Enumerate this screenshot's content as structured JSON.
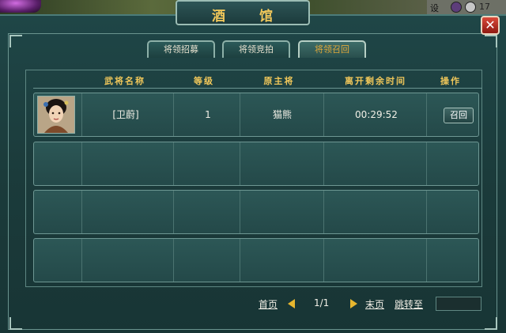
{
  "window": {
    "title_char_1": "酒",
    "title_char_2": "馆",
    "close_label": "✕"
  },
  "topbar": {
    "settings_label": "设",
    "right_digits": "17"
  },
  "tabs": [
    {
      "label": "将领招募",
      "active": false
    },
    {
      "label": "将领竞拍",
      "active": false
    },
    {
      "label": "将领召回",
      "active": true
    }
  ],
  "table": {
    "columns": [
      "武将名称",
      "等级",
      "原主将",
      "离开剩余时间",
      "操作"
    ],
    "rows": [
      {
        "name": "[卫蔚]",
        "level": "1",
        "owner": "猫熊",
        "time_left": "00:29:52",
        "action": "召回"
      }
    ],
    "empty_rows": 3
  },
  "pagination": {
    "first": "首页",
    "page": "1/1",
    "last": "末页",
    "jump": "跳转至",
    "jump_value": ""
  },
  "colors": {
    "accent_gold": "#f0c75a",
    "panel": "#1f4647",
    "arrow": "#e6b62e"
  }
}
